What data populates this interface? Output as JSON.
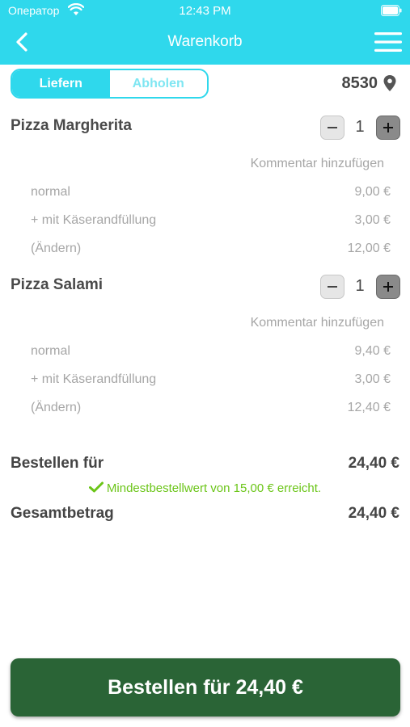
{
  "status_bar": {
    "carrier": "Оператор",
    "time": "12:43 PM"
  },
  "nav": {
    "title": "Warenkorb"
  },
  "delivery": {
    "options": [
      "Liefern",
      "Abholen"
    ],
    "selected": "Liefern",
    "zip": "8530"
  },
  "items": [
    {
      "name": "Pizza Margherita",
      "quantity": "1",
      "comment_label": "Kommentar hinzufügen",
      "details": [
        {
          "label": "normal",
          "price": "9,00 €"
        },
        {
          "label": "+ mit Käserandfüllung",
          "price": "3,00 €"
        },
        {
          "label": "(Ändern)",
          "price": "12,00 €"
        }
      ]
    },
    {
      "name": "Pizza Salami",
      "quantity": "1",
      "comment_label": "Kommentar hinzufügen",
      "details": [
        {
          "label": "normal",
          "price": "9,40 €"
        },
        {
          "label": "+ mit Käserandfüllung",
          "price": "3,00 €"
        },
        {
          "label": "(Ändern)",
          "price": "12,40 €"
        }
      ]
    }
  ],
  "summary": {
    "order_for_label": "Bestellen für",
    "order_for_value": "24,40 €",
    "min_order_message": "Mindestbestellwert von 15,00 € erreicht.",
    "total_label": "Gesamtbetrag",
    "total_value": "24,40 €"
  },
  "order_button": {
    "label": "Bestellen für 24,40 €"
  },
  "colors": {
    "header": "#2fd8ec",
    "order_button": "#2a6436",
    "success": "#6bc518",
    "muted_text": "#a6a6a6"
  }
}
